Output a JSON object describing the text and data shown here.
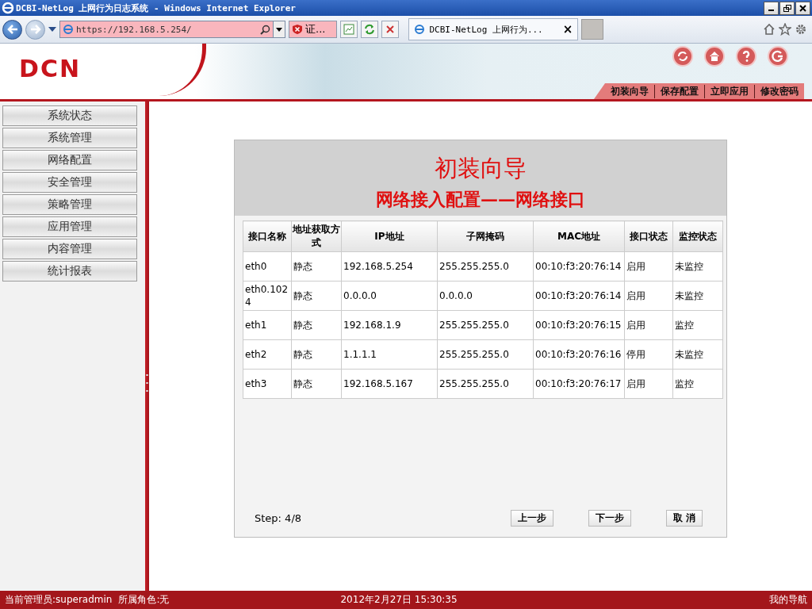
{
  "window": {
    "title": "DCBI-NetLog 上网行为日志系统 - Windows Internet Explorer"
  },
  "browser": {
    "address": "https://192.168.5.254/",
    "cert_label": "证...",
    "tab_title": "DCBI-NetLog 上网行为...",
    "tab_close": "×"
  },
  "header": {
    "logo": "DCN",
    "nav": [
      "初装向导",
      "保存配置",
      "立即应用",
      "修改密码"
    ]
  },
  "sidebar": {
    "items": [
      {
        "label": "系统状态"
      },
      {
        "label": "系统管理"
      },
      {
        "label": "网络配置"
      },
      {
        "label": "安全管理"
      },
      {
        "label": "策略管理"
      },
      {
        "label": "应用管理"
      },
      {
        "label": "内容管理"
      },
      {
        "label": "统计报表"
      }
    ]
  },
  "wizard": {
    "title": "初装向导",
    "subtitle": "网络接入配置——网络接口",
    "columns": [
      "接口名称",
      "地址获取方式",
      "IP地址",
      "子网掩码",
      "MAC地址",
      "接口状态",
      "监控状态"
    ],
    "rows": [
      [
        "eth0",
        "静态",
        "192.168.5.254",
        "255.255.255.0",
        "00:10:f3:20:76:14",
        "启用",
        "未监控"
      ],
      [
        "eth0.1024",
        "静态",
        "0.0.0.0",
        "0.0.0.0",
        "00:10:f3:20:76:14",
        "启用",
        "未监控"
      ],
      [
        "eth1",
        "静态",
        "192.168.1.9",
        "255.255.255.0",
        "00:10:f3:20:76:15",
        "启用",
        "监控"
      ],
      [
        "eth2",
        "静态",
        "1.1.1.1",
        "255.255.255.0",
        "00:10:f3:20:76:16",
        "停用",
        "未监控"
      ],
      [
        "eth3",
        "静态",
        "192.168.5.167",
        "255.255.255.0",
        "00:10:f3:20:76:17",
        "启用",
        "监控"
      ]
    ],
    "step": "Step: 4/8",
    "buttons": [
      "上一步",
      "下一步",
      "取 消"
    ]
  },
  "status_bar": {
    "user": "当前管理员:superadmin",
    "role": "所属角色:无",
    "time": "2012年2月27日 15:30:35",
    "nav": "我的导航"
  }
}
